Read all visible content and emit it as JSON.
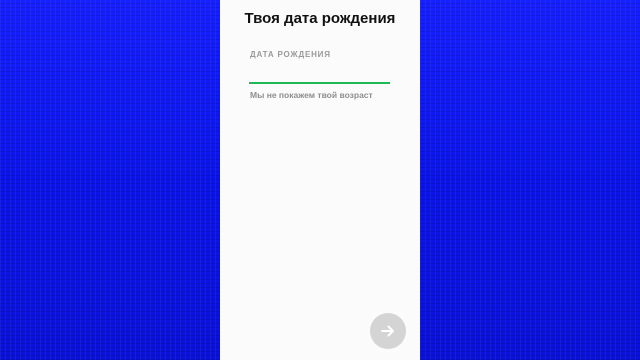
{
  "screen": {
    "title": "Твоя дата рождения",
    "field_label": "ДАТА РОЖДЕНИЯ",
    "field_value": "",
    "hint": "Мы не покажем твой возраст"
  },
  "next_button": {
    "icon": "arrow-right-icon"
  },
  "colors": {
    "background": "#0a14e6",
    "panel": "#fbfbfb",
    "accent": "#1db954",
    "button": "#d4d4d4"
  }
}
